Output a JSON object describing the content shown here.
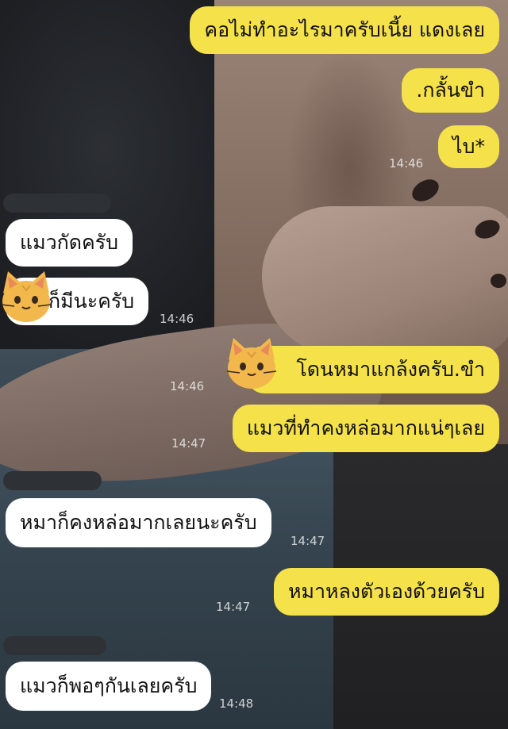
{
  "chat": {
    "messages": [
      {
        "side": "out",
        "text": "คอไม่ทำอะไรมาครับเนี้ย แดงเลย"
      },
      {
        "side": "out",
        "text": ".กลั้นขำ"
      },
      {
        "side": "out",
        "text": "ไบ*",
        "time": "14:46"
      },
      {
        "side": "in",
        "text": "แมวกัดครับ"
      },
      {
        "side": "in",
        "text": "ก็มีนะครับ",
        "time": "14:46",
        "sticker": "cat-face-icon"
      },
      {
        "side": "out",
        "text": "โดนหมาแกล้งครับ.ขำ",
        "time": "14:46",
        "sticker": "cat-face-icon"
      },
      {
        "side": "out",
        "text": "แมวที่ทำคงหล่อมากแน่ๆเลย",
        "time": "14:47"
      },
      {
        "side": "in",
        "text": "หมาก็คงหล่อมากเลยนะครับ",
        "time": "14:47"
      },
      {
        "side": "out",
        "text": "หมาหลงตัวเองด้วยครับ",
        "time": "14:47"
      },
      {
        "side": "in",
        "text": "แมวก็พอๆกันเลยครับ",
        "time": "14:48"
      }
    ]
  },
  "colors": {
    "outgoing_bubble": "#f5e14a",
    "incoming_bubble": "#ffffff",
    "cat_sticker": "#f2b84c"
  }
}
